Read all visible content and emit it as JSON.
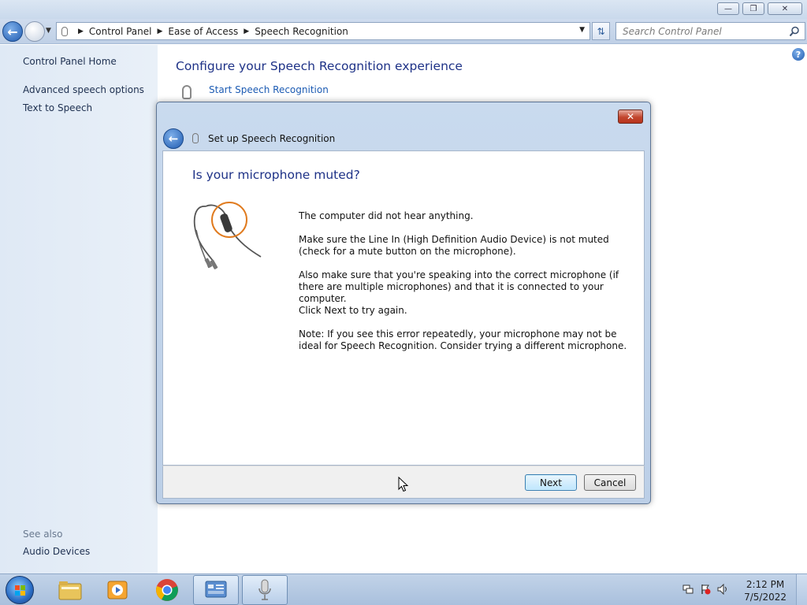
{
  "explorer": {
    "breadcrumb": [
      "Control Panel",
      "Ease of Access",
      "Speech Recognition"
    ],
    "search_placeholder": "Search Control Panel"
  },
  "left_pane": {
    "home": "Control Panel Home",
    "links": [
      "Advanced speech options",
      "Text to Speech"
    ],
    "see_also_label": "See also",
    "see_also_links": [
      "Audio Devices"
    ]
  },
  "main": {
    "heading": "Configure your Speech Recognition experience",
    "start_link": "Start Speech Recognition"
  },
  "dialog": {
    "title": "Set up Speech Recognition",
    "question": "Is your microphone muted?",
    "paragraphs": [
      "The computer did not hear anything.",
      "Make sure the Line In (High Definition Audio Device) is not muted (check for a mute button on the microphone).",
      "Also make sure that you're speaking into the correct microphone (if there are multiple microphones) and that it is connected to your computer.",
      "Click Next to try again.",
      "Note: If you see this error repeatedly, your microphone may not be ideal for Speech Recognition. Consider trying a different microphone."
    ],
    "next_label": "Next",
    "cancel_label": "Cancel"
  },
  "taskbar": {
    "time": "2:12 PM",
    "date": "7/5/2022"
  },
  "colors": {
    "heading_blue": "#1e3287",
    "link_blue": "#1c5bb3",
    "highlight_orange": "#e07b1f"
  }
}
